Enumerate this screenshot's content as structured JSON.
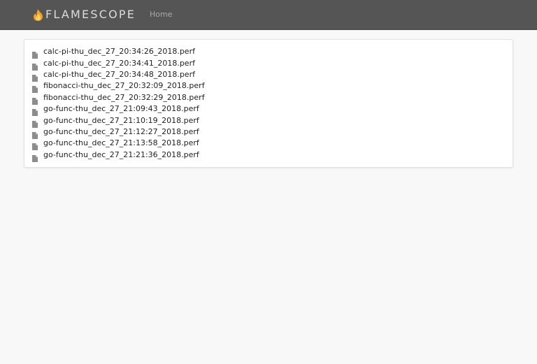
{
  "navbar": {
    "brand": "FLAMESCOPE",
    "brand_icon": "flame-icon",
    "home_label": "Home",
    "background": "#555555"
  },
  "files": {
    "icon": "file-icon",
    "items": [
      "calc-pi-thu_dec_27_20:34:26_2018.perf",
      "calc-pi-thu_dec_27_20:34:41_2018.perf",
      "calc-pi-thu_dec_27_20:34:48_2018.perf",
      "fibonacci-thu_dec_27_20:32:09_2018.perf",
      "fibonacci-thu_dec_27_20:32:29_2018.perf",
      "go-func-thu_dec_27_21:09:43_2018.perf",
      "go-func-thu_dec_27_21:10:19_2018.perf",
      "go-func-thu_dec_27_21:12:27_2018.perf",
      "go-func-thu_dec_27_21:13:58_2018.perf",
      "go-func-thu_dec_27_21:21:36_2018.perf"
    ]
  }
}
